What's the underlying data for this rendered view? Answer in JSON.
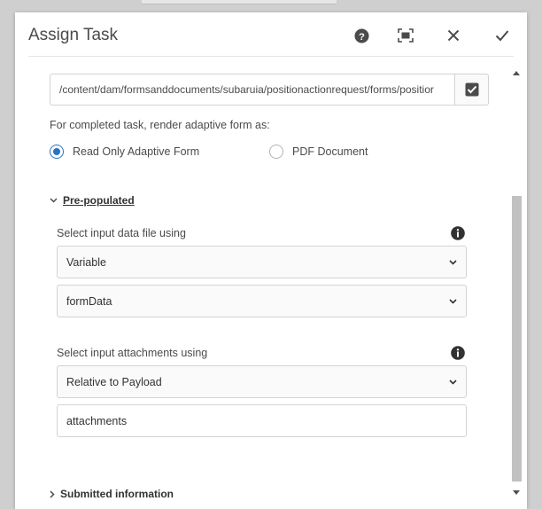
{
  "dialog": {
    "title": "Assign Task",
    "header_buttons": [
      {
        "name": "help",
        "icon": "help-icon"
      },
      {
        "name": "fullscreen",
        "icon": "fullscreen-icon"
      },
      {
        "name": "close",
        "icon": "close-icon"
      },
      {
        "name": "done",
        "icon": "checkmark-icon"
      }
    ]
  },
  "form": {
    "path_value": "/content/dam/formsanddocuments/subaruia/positionactionrequest/forms/positior",
    "render_label": "For completed task, render adaptive form as:",
    "render_options": [
      {
        "label": "Read Only Adaptive Form",
        "checked": true
      },
      {
        "label": "PDF Document",
        "checked": false
      }
    ],
    "prepopulated": {
      "toggle_label": "Pre-populated",
      "expanded": true,
      "data_file_label": "Select input data file using",
      "data_file_mode": "Variable",
      "data_file_variable": "formData",
      "attachments_label": "Select input attachments using",
      "attachments_mode": "Relative to Payload",
      "attachments_path": "attachments"
    },
    "submitted_toggle_label": "Submitted information"
  },
  "colors": {
    "accent": "#2d73c4",
    "icon": "#4b4b4b",
    "border": "#d3d3d3"
  }
}
